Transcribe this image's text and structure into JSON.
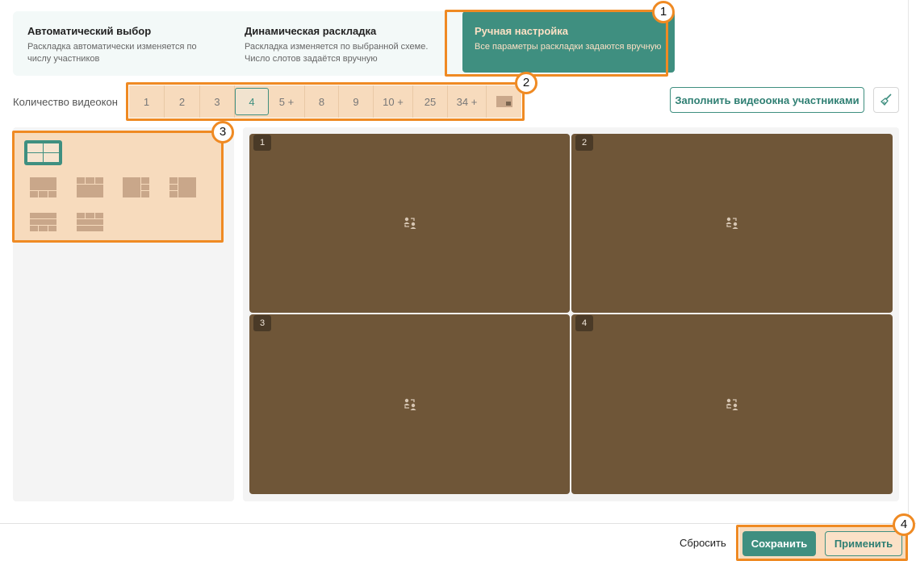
{
  "modes": [
    {
      "title": "Автоматический выбор",
      "desc": "Раскладка автоматически изменяется по числу участников"
    },
    {
      "title": "Динамическая раскладка",
      "desc": "Раскладка изменяется по выбранной схеме. Число слотов задаётся вручную"
    },
    {
      "title": "Ручная настройка",
      "desc": "Все параметры раскладки задаются вручную"
    }
  ],
  "count": {
    "label": "Количество видеокон",
    "options": [
      "1",
      "2",
      "3",
      "4",
      "5 +",
      "8",
      "9",
      "10 +",
      "25",
      "34 +"
    ],
    "selected": "4",
    "custom_icon": "picture-in-picture-icon"
  },
  "actions": {
    "fill_label": "Заполнить видеоокна участниками",
    "clear_icon": "broom-icon"
  },
  "slots": [
    "1",
    "2",
    "3",
    "4"
  ],
  "slot_icon": "participants-swap-icon",
  "footer": {
    "reset_label": "Сбросить",
    "save_label": "Сохранить",
    "apply_label": "Применить"
  },
  "badges": [
    "1",
    "2",
    "3",
    "4"
  ],
  "colors": {
    "accent": "#3f8f80",
    "highlight": "#ef8a23",
    "slot": "#6f5638"
  }
}
